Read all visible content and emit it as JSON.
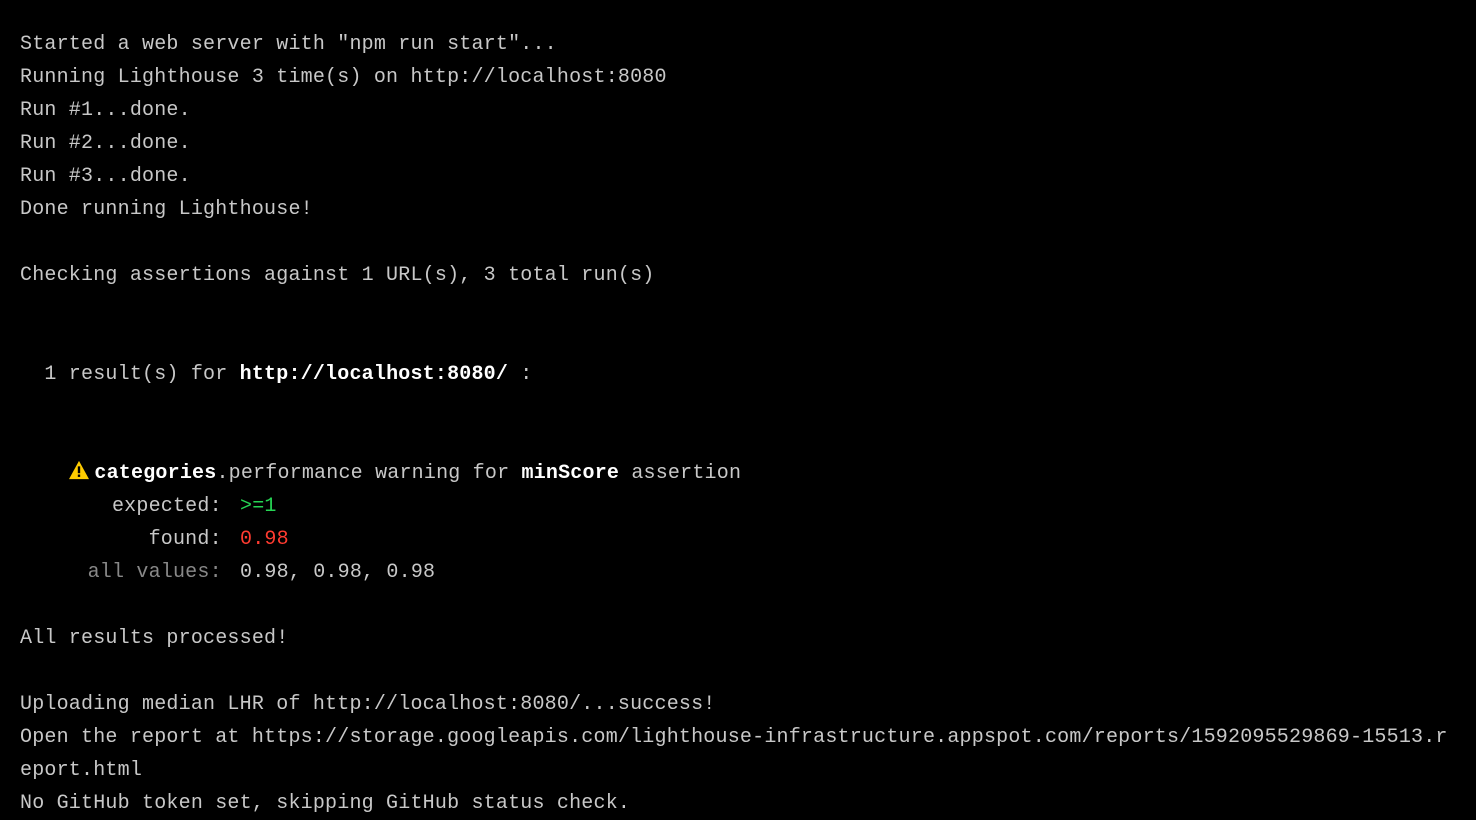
{
  "lines": {
    "start_server": "Started a web server with \"npm run start\"...",
    "running": "Running Lighthouse 3 time(s) on http://localhost:8080",
    "run1": "Run #1...done.",
    "run2": "Run #2...done.",
    "run3": "Run #3...done.",
    "done_running": "Done running Lighthouse!",
    "checking": "Checking assertions against 1 URL(s), 3 total run(s)",
    "result_prefix": "1 result(s) for ",
    "result_url": "http://localhost:8080/",
    "result_suffix": " :",
    "assertion": {
      "categories": "categories",
      "dot_performance": ".performance warning for ",
      "minscore": "minScore",
      "assertion_suffix": " assertion",
      "expected_label": "expected: ",
      "expected_value": ">=1",
      "found_label": "found: ",
      "found_value": "0.98",
      "all_values_label": "all values: ",
      "all_values": "0.98, 0.98, 0.98"
    },
    "all_processed": "All results processed!",
    "uploading": "Uploading median LHR of http://localhost:8080/...success!",
    "open_report": "Open the report at https://storage.googleapis.com/lighthouse-infrastructure.appspot.com/reports/1592095529869-15513.report.html",
    "no_github": "No GitHub token set, skipping GitHub status check."
  }
}
